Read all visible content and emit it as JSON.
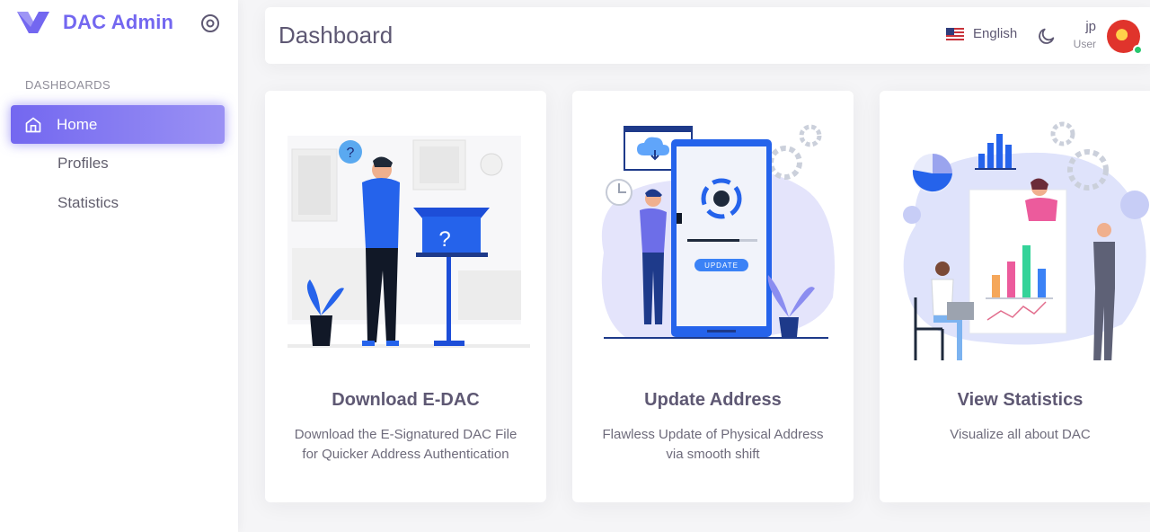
{
  "brand": {
    "name": "DAC Admin",
    "accent": "#7367f0"
  },
  "sidebar": {
    "section_heading": "DASHBOARDS",
    "items": [
      {
        "label": "Home",
        "icon": "home-icon",
        "active": true
      },
      {
        "label": "Profiles",
        "active": false
      },
      {
        "label": "Statistics",
        "active": false
      }
    ]
  },
  "header": {
    "title": "Dashboard",
    "language": "English",
    "language_flag": "us-flag-icon",
    "theme_toggle_icon": "moon-icon",
    "user": {
      "name": "jp",
      "role": "User",
      "status_color": "#28c76f"
    }
  },
  "cards": [
    {
      "title": "Download E-DAC",
      "text": "Download the E-Signatured DAC File for Quicker Address Authentication"
    },
    {
      "title": "Update Address",
      "text": "Flawless Update of Physical Address via smooth shift",
      "update_badge": "UPDATE"
    },
    {
      "title": "View Statistics",
      "text": "Visualize all about DAC"
    }
  ]
}
